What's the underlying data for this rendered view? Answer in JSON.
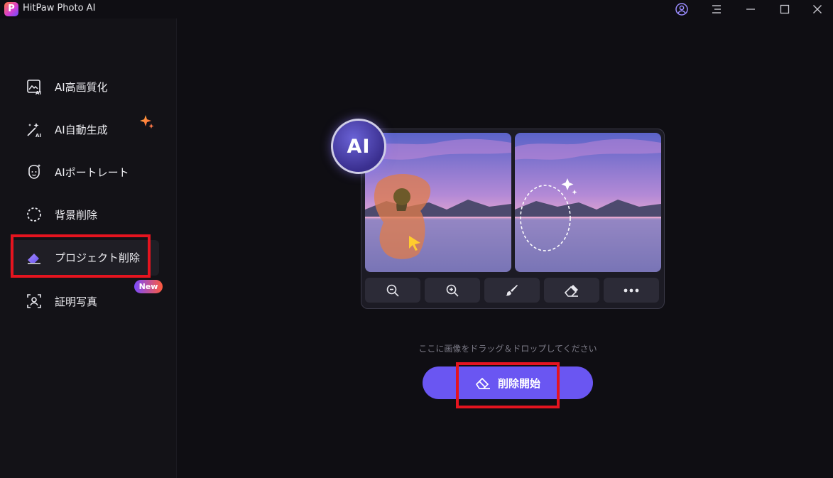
{
  "app": {
    "title": "HitPaw Photo AI",
    "logo_letter": "P"
  },
  "titlebar": {
    "icons": [
      "account-icon",
      "menu-icon",
      "minimize-icon",
      "maximize-icon",
      "close-icon"
    ]
  },
  "sidebar": {
    "items": [
      {
        "label": "AI高画質化",
        "icon": "ai-enhance-icon"
      },
      {
        "label": "AI自動生成",
        "icon": "ai-wand-icon"
      },
      {
        "label": "AIポートレート",
        "icon": "ai-portrait-icon"
      },
      {
        "label": "背景削除",
        "icon": "background-remove-icon"
      },
      {
        "label": "プロジェクト削除",
        "icon": "eraser-icon",
        "active": true
      },
      {
        "label": "証明写真",
        "icon": "id-photo-icon",
        "badge": "New"
      }
    ]
  },
  "preview": {
    "ai_badge": "AI",
    "tools": [
      "zoom-out-icon",
      "zoom-in-icon",
      "brush-icon",
      "eraser-icon",
      "more-icon"
    ]
  },
  "main": {
    "drop_hint": "ここに画像をドラッグ＆ドロップしてください",
    "start_button": "削除開始"
  },
  "colors": {
    "accent": "#6a56f2",
    "highlight": "#e5141f",
    "background": "#0f0e13",
    "sidebar": "#131217"
  }
}
